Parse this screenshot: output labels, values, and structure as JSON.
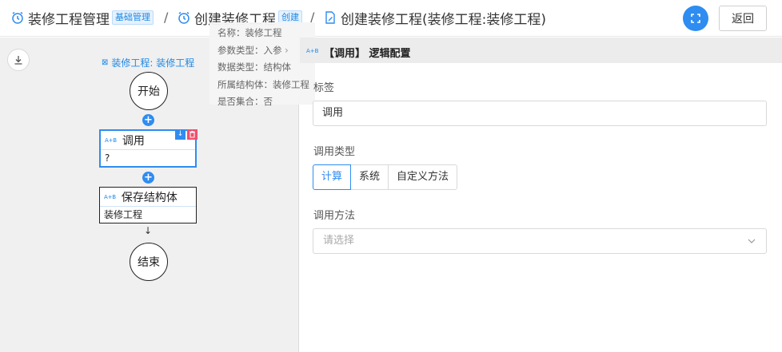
{
  "breadcrumb": {
    "items": [
      {
        "title": "装修工程管理",
        "tag": "基础管理"
      },
      {
        "title": "创建装修工程",
        "tag": "创建"
      },
      {
        "title": "创建装修工程(装修工程:装修工程)"
      }
    ],
    "separator": "/"
  },
  "header": {
    "back_label": "返回"
  },
  "canvas": {
    "struct_label": "装修工程: 装修工程",
    "start_label": "开始",
    "end_label": "结束",
    "plus_symbol": "+",
    "nodes": [
      {
        "badge": "A+B",
        "title": "调用",
        "value": "?"
      },
      {
        "badge": "A+B",
        "title": "保存结构体",
        "value": "装修工程"
      }
    ]
  },
  "tooltip": {
    "lines": [
      "名称：装修工程",
      "参数类型：入参",
      "数据类型：结构体",
      "所属结构体：装修工程",
      "是否集合：否"
    ]
  },
  "panel": {
    "badge": "A+B",
    "title": "【调用】 逻辑配置",
    "label_field": {
      "label": "标签",
      "value": "调用"
    },
    "call_type": {
      "label": "调用类型",
      "options": [
        "计算",
        "系统",
        "自定义方法"
      ],
      "selected": "计算"
    },
    "call_method": {
      "label": "调用方法",
      "placeholder": "请选择"
    }
  },
  "colors": {
    "primary": "#2f8cf0",
    "danger": "#f0506e",
    "tag_bg": "#e6f2fd"
  }
}
